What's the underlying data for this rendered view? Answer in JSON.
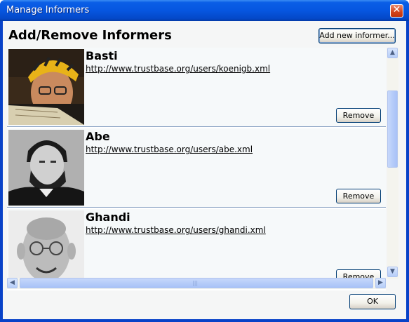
{
  "window": {
    "title": "Manage Informers"
  },
  "dialog": {
    "heading": "Add/Remove Informers",
    "add_button": "Add new informer...",
    "ok_button": "OK"
  },
  "informers": [
    {
      "name": "Basti",
      "url": "http://www.trustbase.org/users/koenigb.xml",
      "remove_label": "Remove"
    },
    {
      "name": "Abe",
      "url": "http://www.trustbase.org/users/abe.xml",
      "remove_label": "Remove"
    },
    {
      "name": "Ghandi",
      "url": "http://www.trustbase.org/users/ghandi.xml",
      "remove_label": "Remove"
    }
  ],
  "icons": {
    "close": "close-icon",
    "scroll_up": "arrow-up-icon",
    "scroll_down": "arrow-down-icon",
    "scroll_left": "arrow-left-icon",
    "scroll_right": "arrow-right-icon"
  },
  "colors": {
    "titlebar": "#0656e0",
    "button_border": "#003c74",
    "row_divider": "#8ca4c4"
  }
}
